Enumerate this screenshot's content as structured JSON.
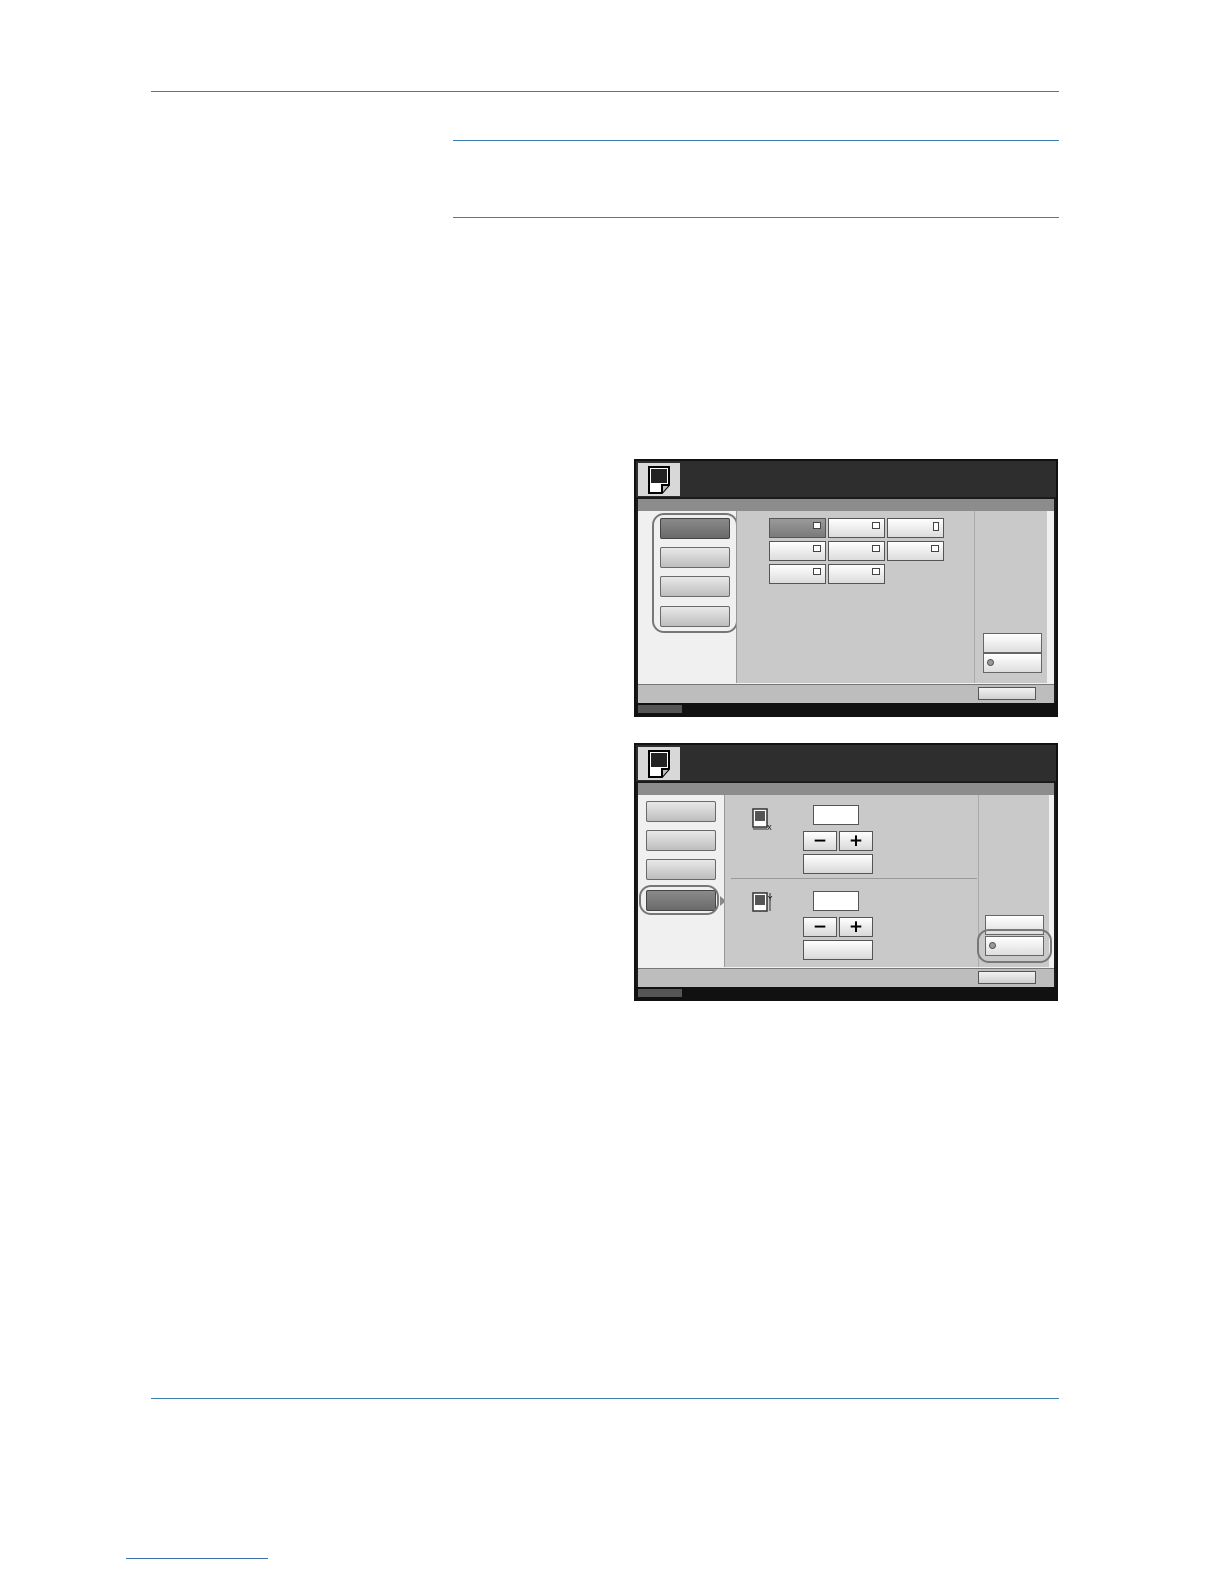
{
  "page": {
    "header_rule": true,
    "note_box_rules": true,
    "footer_rule": true
  },
  "panels": [
    {
      "id": "paper-size-screen",
      "tabs": [
        "",
        "",
        "",
        ""
      ],
      "active_tab": 0,
      "size_buttons": [
        "",
        "",
        "",
        "",
        "",
        "",
        "",
        ""
      ],
      "selected_size": 0,
      "side_buttons": [
        "",
        ""
      ],
      "ok_label": ""
    },
    {
      "id": "size-entry-screen",
      "tabs": [
        "",
        "",
        "",
        ""
      ],
      "active_tab": 3,
      "x_value": "",
      "y_value": "",
      "side_buttons": [
        "",
        ""
      ],
      "ok_label": ""
    }
  ],
  "icons": {
    "title": "document-icon",
    "x_dimension": "width-dimension-icon",
    "y_dimension": "height-dimension-icon",
    "minus": "−",
    "plus": "+"
  },
  "colors": {
    "rule": "#3a7fb0",
    "panel_title": "#2e2e2e",
    "panel_bg": "#c9c9c9"
  }
}
